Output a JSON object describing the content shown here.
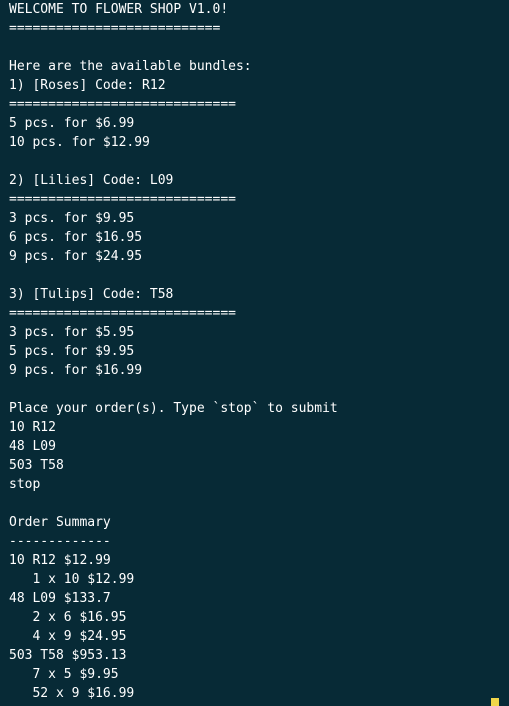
{
  "header": {
    "title": "WELCOME TO FLOWER SHOP V1.0!",
    "underline": "==========================="
  },
  "bundles_intro": "Here are the available bundles:",
  "bundles": [
    {
      "heading": "1) [Roses] Code: R12",
      "underline": "=============================",
      "options": [
        "5 pcs. for $6.99",
        "10 pcs. for $12.99"
      ]
    },
    {
      "heading": "2) [Lilies] Code: L09",
      "underline": "=============================",
      "options": [
        "3 pcs. for $9.95",
        "6 pcs. for $16.95",
        "9 pcs. for $24.95"
      ]
    },
    {
      "heading": "3) [Tulips] Code: T58",
      "underline": "=============================",
      "options": [
        "3 pcs. for $5.95",
        "5 pcs. for $9.95",
        "9 pcs. for $16.99"
      ]
    }
  ],
  "order_prompt": "Place your order(s). Type `stop` to submit",
  "order_inputs": [
    "10 R12",
    "48 L09",
    "503 T58",
    "stop"
  ],
  "summary": {
    "title": "Order Summary",
    "underline": "-------------",
    "lines": [
      "10 R12 $12.99",
      "   1 x 10 $12.99",
      "48 L09 $133.7",
      "   2 x 6 $16.95",
      "   4 x 9 $24.95",
      "503 T58 $953.13",
      "   7 x 5 $9.95",
      "   52 x 9 $16.99"
    ]
  },
  "colors": {
    "background": "#072a36",
    "text": "#ffffff",
    "cursor": "#f0d64a"
  }
}
